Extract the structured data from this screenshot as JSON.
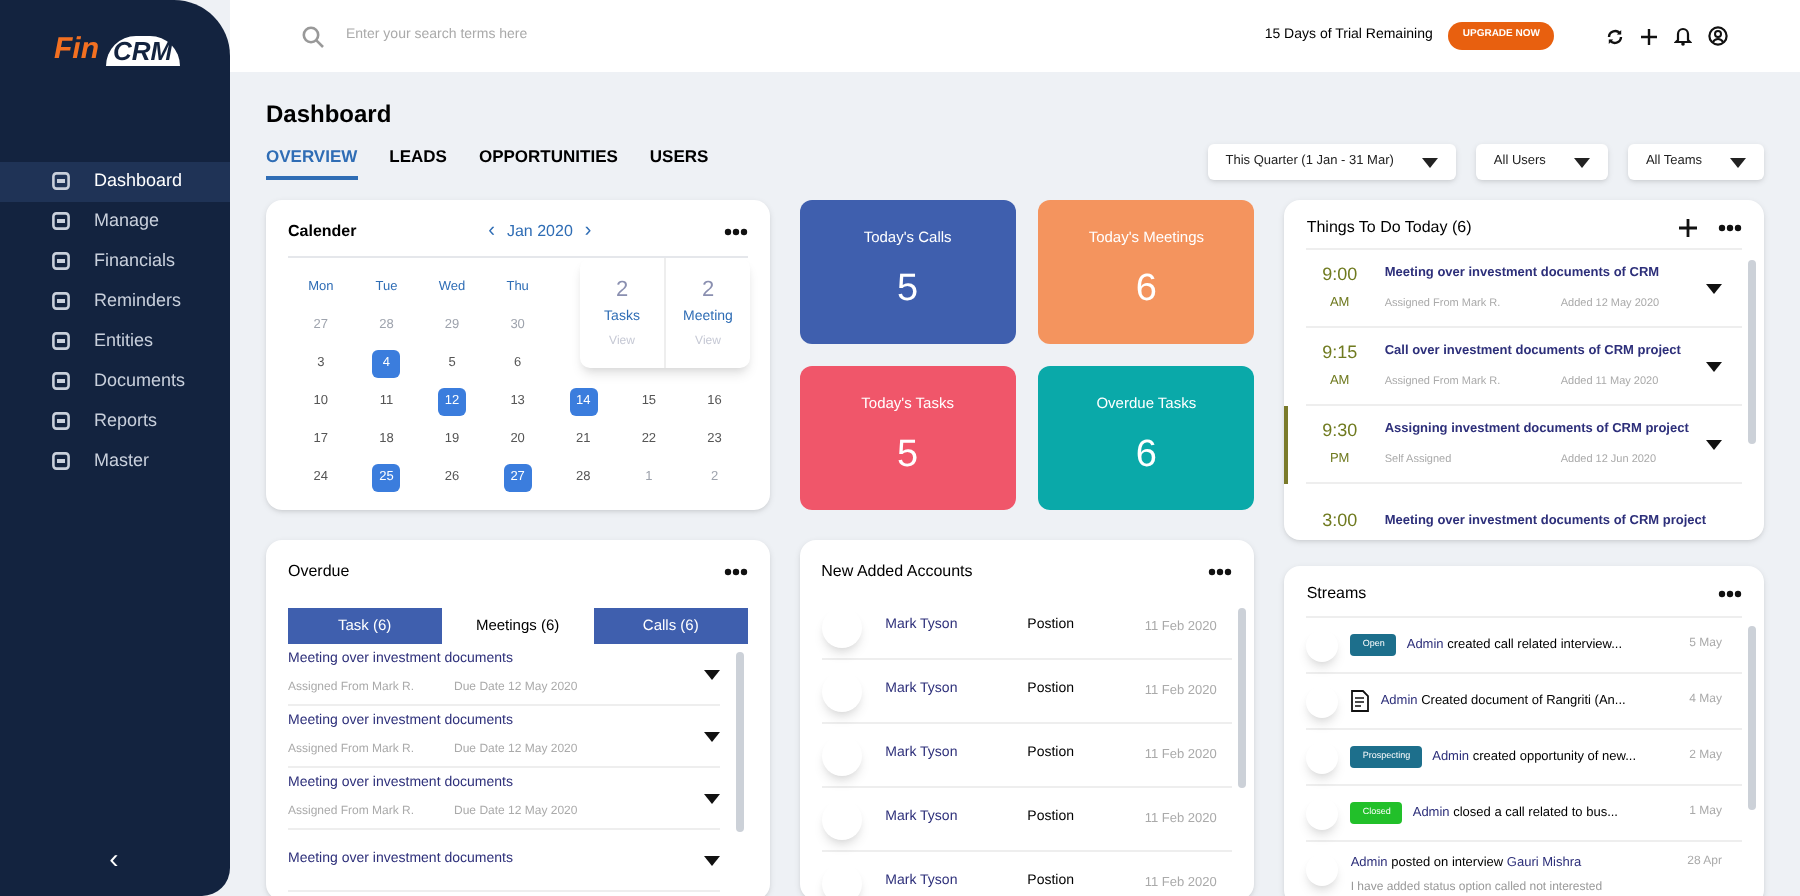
{
  "sidebar": {
    "logo": {
      "left": "Fin",
      "right": "CRM"
    },
    "items": [
      {
        "label": "Dashboard",
        "selected": true
      },
      {
        "label": "Manage",
        "selected": false
      },
      {
        "label": "Financials",
        "selected": false
      },
      {
        "label": "Reminders",
        "selected": false
      },
      {
        "label": "Entities",
        "selected": false
      },
      {
        "label": "Documents",
        "selected": false
      },
      {
        "label": "Reports",
        "selected": false
      },
      {
        "label": "Master",
        "selected": false
      }
    ],
    "collapse": "‹"
  },
  "topbar": {
    "search": {
      "placeholder": "Enter your search terms here"
    },
    "trial": "15 Days of Trial Remaining",
    "upgrade": "UPGRADE NOW"
  },
  "page": {
    "title": "Dashboard",
    "tabs": [
      {
        "label": "OVERVIEW",
        "selected": true
      },
      {
        "label": "LEADS",
        "selected": false
      },
      {
        "label": "OPPORTUNITIES",
        "selected": false
      },
      {
        "label": "USERS",
        "selected": false
      }
    ],
    "filters": [
      "This Quarter (1 Jan - 31 Mar)",
      "All Users",
      "All Teams"
    ]
  },
  "calendar": {
    "title": "Calender",
    "prev": "‹",
    "month": "Jan 2020",
    "next": "›",
    "weekdays": [
      "Mon",
      "Tue",
      "Wed",
      "Thu"
    ],
    "weeks": [
      [
        {
          "d": "27",
          "outside": true,
          "selected": false
        },
        {
          "d": "28",
          "outside": true,
          "selected": false
        },
        {
          "d": "29",
          "outside": true,
          "selected": false
        },
        {
          "d": "30",
          "outside": true,
          "selected": false
        }
      ],
      [
        {
          "d": "3",
          "outside": false,
          "selected": false
        },
        {
          "d": "4",
          "outside": false,
          "selected": true
        },
        {
          "d": "5",
          "outside": false,
          "selected": false
        },
        {
          "d": "6",
          "outside": false,
          "selected": false
        }
      ],
      [
        {
          "d": "10",
          "outside": false,
          "selected": false
        },
        {
          "d": "11",
          "outside": false,
          "selected": false
        },
        {
          "d": "12",
          "outside": false,
          "selected": true
        },
        {
          "d": "13",
          "outside": false,
          "selected": false
        },
        {
          "d": "14",
          "outside": false,
          "selected": true
        },
        {
          "d": "15",
          "outside": false,
          "selected": false
        },
        {
          "d": "16",
          "outside": false,
          "selected": false
        }
      ],
      [
        {
          "d": "17",
          "outside": false,
          "selected": false
        },
        {
          "d": "18",
          "outside": false,
          "selected": false
        },
        {
          "d": "19",
          "outside": false,
          "selected": false
        },
        {
          "d": "20",
          "outside": false,
          "selected": false
        },
        {
          "d": "21",
          "outside": false,
          "selected": false
        },
        {
          "d": "22",
          "outside": false,
          "selected": false
        },
        {
          "d": "23",
          "outside": false,
          "selected": false
        }
      ],
      [
        {
          "d": "24",
          "outside": false,
          "selected": false
        },
        {
          "d": "25",
          "outside": false,
          "selected": true
        },
        {
          "d": "26",
          "outside": false,
          "selected": false
        },
        {
          "d": "27",
          "outside": false,
          "selected": true
        },
        {
          "d": "28",
          "outside": false,
          "selected": false
        },
        {
          "d": "1",
          "outside": true,
          "selected": false
        },
        {
          "d": "2",
          "outside": true,
          "selected": false
        }
      ]
    ],
    "popup": [
      {
        "count": "2",
        "label": "Tasks",
        "link": "View"
      },
      {
        "count": "2",
        "label": "Meeting",
        "link": "View"
      }
    ]
  },
  "tiles": [
    {
      "label": "Today's Calls",
      "value": "5",
      "color": "#3f5fae"
    },
    {
      "label": "Today's Meetings",
      "value": "6",
      "color": "#f4945e"
    },
    {
      "label": "Today's Tasks",
      "value": "5",
      "color": "#f0566a"
    },
    {
      "label": "Overdue Tasks",
      "value": "6",
      "color": "#0aa9a9"
    }
  ],
  "todo": {
    "title": "Things To Do Today (6)",
    "items": [
      {
        "time": "9:00",
        "period": "AM",
        "title": "Meeting over investment documents of CRM",
        "assigned": "Assigned From Mark R.",
        "added": "Added 12 May 2020",
        "highlighted": false
      },
      {
        "time": "9:15",
        "period": "AM",
        "title": "Call over investment documents of CRM project",
        "assigned": "Assigned From Mark R.",
        "added": "Added 11 May 2020",
        "highlighted": false
      },
      {
        "time": "9:30",
        "period": "PM",
        "title": "Assigning investment documents of CRM project",
        "assigned": "Self Assigned",
        "added": "Added 12 Jun 2020",
        "highlighted": true
      },
      {
        "time": "3:00",
        "title": "Meeting over investment documents of CRM project",
        "highlighted": false
      }
    ]
  },
  "overdue": {
    "title": "Overdue",
    "tabs": [
      {
        "label": "Task (6)",
        "selected": false
      },
      {
        "label": "Meetings (6)",
        "selected": true
      },
      {
        "label": "Calls (6)",
        "selected": false
      }
    ],
    "items": [
      {
        "title": "Meeting over investment documents",
        "assigned": "Assigned From Mark R.",
        "due": "Due Date 12 May 2020"
      },
      {
        "title": "Meeting over investment documents",
        "assigned": "Assigned From Mark R.",
        "due": "Due Date 12 May 2020"
      },
      {
        "title": "Meeting over investment documents",
        "assigned": "Assigned From Mark R.",
        "due": "Due Date 12 May 2020"
      },
      {
        "title": "Meeting over investment documents"
      }
    ]
  },
  "accounts": {
    "title": "New Added Accounts",
    "rows": [
      {
        "name": "Mark Tyson",
        "position": "Postion",
        "date": "11 Feb 2020"
      },
      {
        "name": "Mark Tyson",
        "position": "Postion",
        "date": "11 Feb 2020"
      },
      {
        "name": "Mark Tyson",
        "position": "Postion",
        "date": "11 Feb 2020"
      },
      {
        "name": "Mark Tyson",
        "position": "Postion",
        "date": "11 Feb 2020"
      },
      {
        "name": "Mark Tyson",
        "position": "Postion",
        "date": "11 Feb 2020"
      }
    ]
  },
  "streams": {
    "title": "Streams",
    "items": [
      {
        "kind": "badge",
        "badge": "Open",
        "color": "#1d6f8c",
        "user": "Admin",
        "text": "created call related interview...",
        "date": "5 May"
      },
      {
        "kind": "document",
        "user": "Admin",
        "text": "Created document of Rangriti (An...",
        "date": "4 May"
      },
      {
        "kind": "badge",
        "badge": "Prospecting",
        "color": "#1d6f8c",
        "user": "Admin",
        "text": "created opportunity of new...",
        "date": "2 May"
      },
      {
        "kind": "badge",
        "badge": "Closed",
        "color": "#22c02a",
        "user": "Admin",
        "text": "closed a call related to bus...",
        "date": "1 May"
      },
      {
        "kind": "post",
        "user": "Admin",
        "text": "posted on interview",
        "target": "Gauri Mishra",
        "note": "I have added status option called not interested",
        "date": "28 Apr"
      }
    ]
  }
}
